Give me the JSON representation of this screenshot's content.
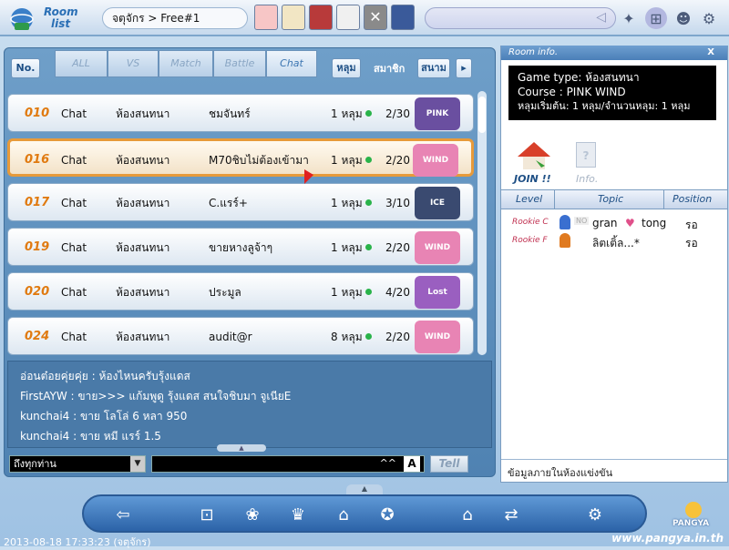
{
  "topbar": {
    "logo_line1": "Room",
    "logo_line2": "list",
    "channel": "จตุจักร > Free#1"
  },
  "filters": {
    "no_label": "No.",
    "tabs": [
      "ALL",
      "VS",
      "Match",
      "Battle",
      "Chat"
    ],
    "sort_buttons": [
      "หลุม",
      "สมาชิก",
      "สนาม"
    ]
  },
  "rooms": [
    {
      "no": "010",
      "type": "Chat",
      "mode": "ห้องสนทนา",
      "name": "ชมจันทร์",
      "holes": "1 หลุม",
      "players": "2/30",
      "course": "PINK WIND",
      "course_color": "#6a4fa0"
    },
    {
      "no": "016",
      "type": "Chat",
      "mode": "ห้องสนทนา",
      "name": "M70ชิบไม่ต้องเข้ามา",
      "holes": "1 หลุม",
      "players": "2/20",
      "course": "WIND",
      "course_color": "#e884b4"
    },
    {
      "no": "017",
      "type": "Chat",
      "mode": "ห้องสนทนา",
      "name": "C.แรร์+",
      "holes": "1 หลุม",
      "players": "3/10",
      "course": "ICE INFERNO",
      "course_color": "#3a4a70"
    },
    {
      "no": "019",
      "type": "Chat",
      "mode": "ห้องสนทนา",
      "name": "ขายหางลูจ้าๆ",
      "holes": "1 หลุม",
      "players": "2/20",
      "course": "WIND",
      "course_color": "#e884b4"
    },
    {
      "no": "020",
      "type": "Chat",
      "mode": "ห้องสนทนา",
      "name": "ประมูล",
      "holes": "1 หลุม",
      "players": "4/20",
      "course": "Lost Seaway",
      "course_color": "#9a5fc0"
    },
    {
      "no": "024",
      "type": "Chat",
      "mode": "ห้องสนทนา",
      "name": "audit@r",
      "holes": "8 หลุม",
      "players": "2/20",
      "course": "WIND",
      "course_color": "#e884b4"
    }
  ],
  "chatlog": [
    "อ่อนต๋อยคุ่ยคุ่ย : ห้องไหนครับรุ้งแดส",
    "FirstAYW : ขาย>>> แก้มพูดู รุ้งแดส สนใจชิบมา จูเนียE",
    "kunchai4 : ขาย โลโล่ 6 หลา 950",
    "kunchai4 : ขาย  หมี แรร์ 1.5"
  ],
  "chatbar": {
    "target": "ถึงทุกท่าน",
    "caret_label": "^^",
    "a_label": "A",
    "tell_label": "Tell"
  },
  "room_info": {
    "title": "Room info.",
    "close": "X",
    "game_type": "Game type: ห้องสนทนา",
    "course": "Course : PINK WIND",
    "holes": "หลุมเริ่มต้น: 1 หลุม/จำนวนหลุม: 1 หลุม",
    "join_label": "JOIN !!",
    "info_label": "Info.",
    "columns": [
      "Level",
      "Topic",
      "Position"
    ],
    "players": [
      {
        "level": "Rookie C",
        "no_badge": "NO",
        "name": "gran",
        "partner": "tong",
        "position": "รอ"
      },
      {
        "level": "Rookie F",
        "no_badge": "",
        "name": "ลิตเติ้ล...*",
        "partner": "",
        "position": "รอ"
      }
    ],
    "footer": "ข้อมูลภายในห้องแข่งขัน"
  },
  "status": {
    "timestamp": "2013-08-18 17:33:23 (จตุจักร)",
    "site": "www.pangya.in.th",
    "brand": "PANGYA"
  },
  "colors": {
    "accent": "#e07a10",
    "online_dot": "#2ab34a"
  }
}
